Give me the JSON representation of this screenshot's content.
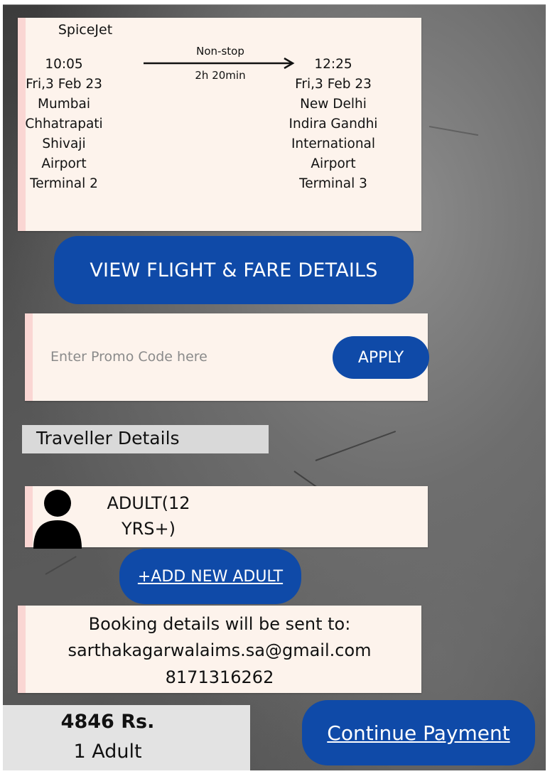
{
  "flight": {
    "airline": "SpiceJet",
    "stops": "Non-stop",
    "duration": "2h 20min",
    "departure": {
      "time": "10:05",
      "date": "Fri,3 Feb 23",
      "city": "Mumbai",
      "airport_lines": [
        "Chhatrapati",
        "Shivaji",
        "Airport"
      ],
      "terminal": "Terminal 2"
    },
    "arrival": {
      "time": "12:25",
      "date": "Fri,3 Feb 23",
      "city": "New Delhi",
      "airport_lines": [
        "Indira Gandhi",
        "International",
        "Airport"
      ],
      "terminal": "Terminal 3"
    }
  },
  "view_details_label": "VIEW FLIGHT & FARE DETAILS",
  "promo": {
    "placeholder": "Enter Promo Code here",
    "apply_label": "APPLY"
  },
  "traveller": {
    "section_title": "Traveller Details",
    "adult_label_line1": "ADULT(12",
    "adult_label_line2": "YRS+)",
    "add_adult_label": "+ADD NEW ADULT"
  },
  "booking": {
    "heading": "Booking details will be sent to:",
    "email": "sarthakagarwalaims.sa@gmail.com",
    "phone": "8171316262"
  },
  "summary": {
    "price": "4846 Rs.",
    "passengers": "1 Adult"
  },
  "continue_label": "Continue Payment",
  "colors": {
    "accent": "#0f4aa8",
    "card": "#fdf3ec",
    "stripe": "#fad6d3"
  }
}
